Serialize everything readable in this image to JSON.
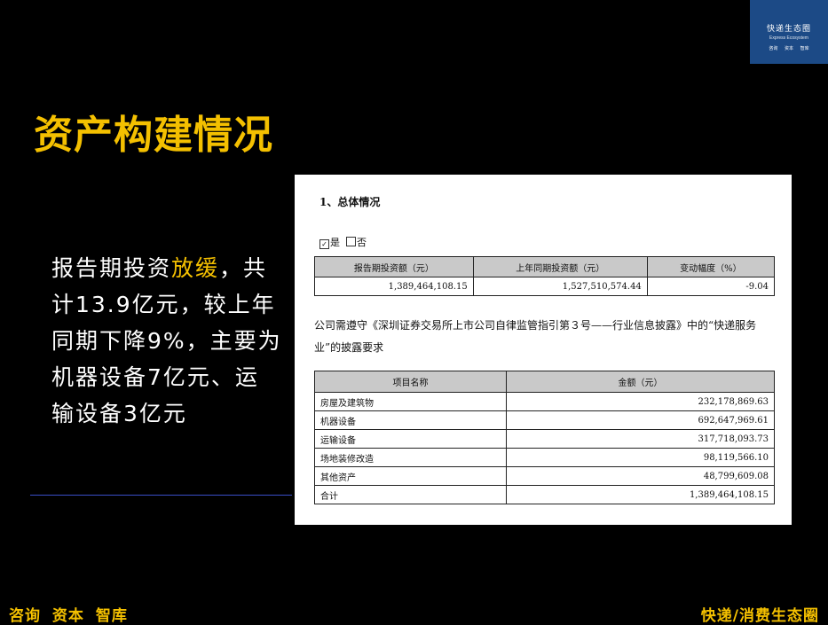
{
  "logo": {
    "title": "快递生态圈",
    "subtitle": "Express Ecosystem",
    "tags": "咨询 资本 智库"
  },
  "slide_title": "资产构建情况",
  "summary": {
    "part1": "报告期投资",
    "highlight": "放缓",
    "part2": "，共计13.9亿元，较上年同期下降9%，主要为机器设备7亿元、运输设备3亿元"
  },
  "doc": {
    "section_title": "1、总体情况",
    "yes_label": "是",
    "no_label": "否",
    "overview_headers": [
      "报告期投资额（元）",
      "上年同期投资额（元）",
      "变动幅度（%）"
    ],
    "overview_values": [
      "1,389,464,108.15",
      "1,527,510,574.44",
      "-9.04"
    ],
    "paragraph": "公司需遵守《深圳证券交易所上市公司自律监管指引第３号——行业信息披露》中的“快递服务业”的披露要求",
    "detail_headers": [
      "项目名称",
      "金额（元）"
    ],
    "detail_rows": [
      {
        "name": "房屋及建筑物",
        "amount": "232,178,869.63"
      },
      {
        "name": "机器设备",
        "amount": "692,647,969.61"
      },
      {
        "name": "运输设备",
        "amount": "317,718,093.73"
      },
      {
        "name": "场地装修改造",
        "amount": "98,119,566.10"
      },
      {
        "name": "其他资产",
        "amount": "48,799,609.08"
      },
      {
        "name": "合计",
        "amount": "1,389,464,108.15"
      }
    ]
  },
  "footer": {
    "left": "咨询 资本 智库",
    "right": "快递/消费生态圈"
  },
  "colors": {
    "background": "#000000",
    "accent": "#f4c000",
    "logo_bg": "#1c4a86"
  }
}
